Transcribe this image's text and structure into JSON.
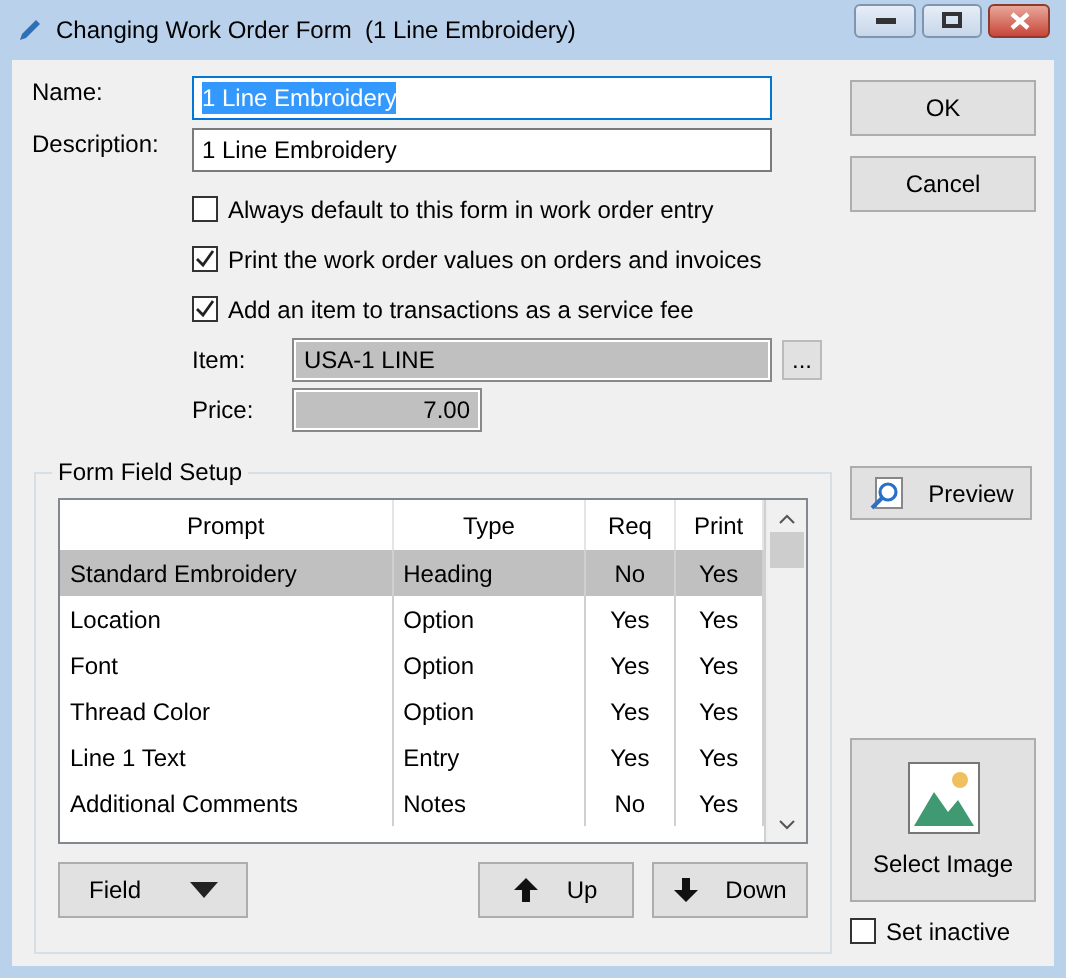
{
  "window": {
    "title": "Changing Work Order Form  (1 Line Embroidery)"
  },
  "fields": [
    {
      "label": "Name:",
      "value": "1 Line Embroidery",
      "text_selected": true
    },
    {
      "label": "Description:",
      "value": "1 Line Embroidery",
      "text_selected": false
    }
  ],
  "options": [
    {
      "label": "Always default to this form in work order entry",
      "checked": false
    },
    {
      "label": "Print the work order values on orders and invoices",
      "checked": true
    },
    {
      "label": "Add an item to transactions as a service fee",
      "checked": true
    }
  ],
  "item": {
    "label": "Item:",
    "value": "USA-1 LINE",
    "browse": "..."
  },
  "price": {
    "label": "Price:",
    "value": "7.00"
  },
  "buttons": {
    "ok": "OK",
    "cancel": "Cancel",
    "preview": "Preview",
    "select_image": "Select Image"
  },
  "form_field_setup": {
    "title": "Form Field Setup",
    "columns": [
      "Prompt",
      "Type",
      "Req",
      "Print"
    ],
    "rows": [
      {
        "cells": [
          "Standard Embroidery",
          "Heading",
          "No",
          "Yes"
        ],
        "selected": true
      },
      {
        "cells": [
          "Location",
          "Option",
          "Yes",
          "Yes"
        ],
        "selected": false
      },
      {
        "cells": [
          "Font",
          "Option",
          "Yes",
          "Yes"
        ],
        "selected": false
      },
      {
        "cells": [
          "Thread Color",
          "Option",
          "Yes",
          "Yes"
        ],
        "selected": false
      },
      {
        "cells": [
          "Line 1 Text",
          "Entry",
          "Yes",
          "Yes"
        ],
        "selected": false
      },
      {
        "cells": [
          "Additional Comments",
          "Notes",
          "No",
          "Yes"
        ],
        "selected": false
      }
    ],
    "field_button": "Field",
    "up_button": "Up",
    "down_button": "Down"
  },
  "set_inactive": {
    "label": "Set inactive",
    "checked": false
  }
}
